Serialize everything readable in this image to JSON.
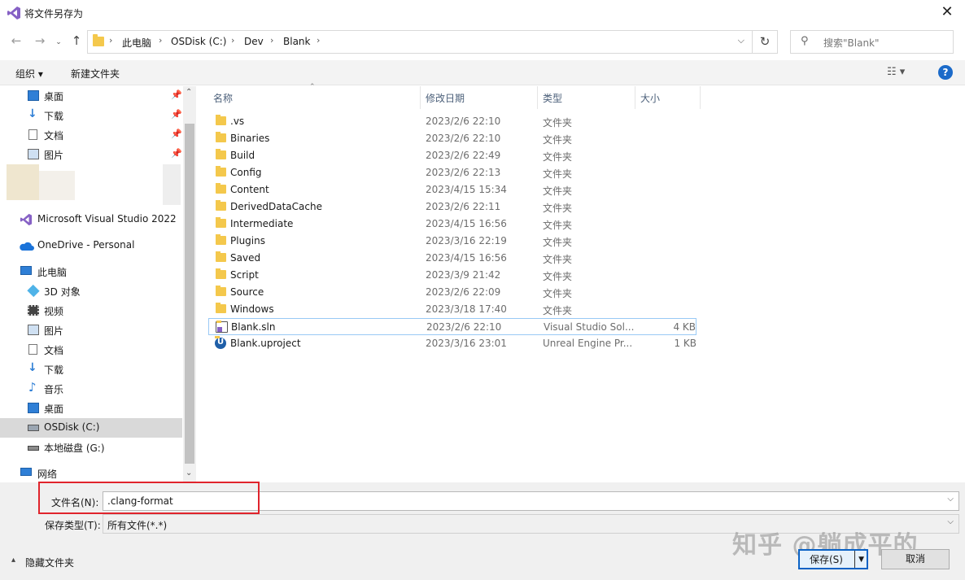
{
  "window": {
    "title": "将文件另存为",
    "close": "✕"
  },
  "address": {
    "crumbs": [
      "此电脑",
      "OSDisk (C:)",
      "Dev",
      "Blank"
    ],
    "search_placeholder": "搜索\"Blank\""
  },
  "toolbar": {
    "organize": "组织 ▾",
    "new_folder": "新建文件夹",
    "help": "?"
  },
  "nav": {
    "quick": [
      {
        "label": "桌面",
        "icon": "desktop-icon"
      },
      {
        "label": "下载",
        "icon": "download-icon"
      },
      {
        "label": "文档",
        "icon": "document-icon"
      },
      {
        "label": "图片",
        "icon": "picture-icon"
      }
    ],
    "vs": "Microsoft Visual Studio 2022",
    "onedrive": "OneDrive - Personal",
    "pc": "此电脑",
    "pc_items": [
      {
        "label": "3D 对象",
        "icon": "3d-objects-icon"
      },
      {
        "label": "视频",
        "icon": "video-icon"
      },
      {
        "label": "图片",
        "icon": "picture-icon"
      },
      {
        "label": "文档",
        "icon": "document-icon"
      },
      {
        "label": "下载",
        "icon": "download-icon"
      },
      {
        "label": "音乐",
        "icon": "music-icon"
      },
      {
        "label": "桌面",
        "icon": "desktop-icon"
      },
      {
        "label": "OSDisk (C:)",
        "icon": "drive-c-icon"
      },
      {
        "label": "本地磁盘 (G:)",
        "icon": "drive-g-icon"
      }
    ],
    "network": "网络"
  },
  "columns": [
    "名称",
    "修改日期",
    "类型",
    "大小"
  ],
  "files": [
    {
      "name": ".vs",
      "date": "2023/2/6 22:10",
      "type": "文件夹",
      "size": ""
    },
    {
      "name": "Binaries",
      "date": "2023/2/6 22:10",
      "type": "文件夹",
      "size": ""
    },
    {
      "name": "Build",
      "date": "2023/2/6 22:49",
      "type": "文件夹",
      "size": ""
    },
    {
      "name": "Config",
      "date": "2023/2/6 22:13",
      "type": "文件夹",
      "size": ""
    },
    {
      "name": "Content",
      "date": "2023/4/15 15:34",
      "type": "文件夹",
      "size": ""
    },
    {
      "name": "DerivedDataCache",
      "date": "2023/2/6 22:11",
      "type": "文件夹",
      "size": ""
    },
    {
      "name": "Intermediate",
      "date": "2023/4/15 16:56",
      "type": "文件夹",
      "size": ""
    },
    {
      "name": "Plugins",
      "date": "2023/3/16 22:19",
      "type": "文件夹",
      "size": ""
    },
    {
      "name": "Saved",
      "date": "2023/4/15 16:56",
      "type": "文件夹",
      "size": ""
    },
    {
      "name": "Script",
      "date": "2023/3/9 21:42",
      "type": "文件夹",
      "size": ""
    },
    {
      "name": "Source",
      "date": "2023/2/6 22:09",
      "type": "文件夹",
      "size": ""
    },
    {
      "name": "Windows",
      "date": "2023/3/18 17:40",
      "type": "文件夹",
      "size": ""
    },
    {
      "name": "Blank.sln",
      "date": "2023/2/6 22:10",
      "type": "Visual Studio Sol...",
      "size": "4 KB"
    },
    {
      "name": "Blank.uproject",
      "date": "2023/3/16 23:01",
      "type": "Unreal Engine Pr...",
      "size": "1 KB"
    }
  ],
  "form": {
    "filename_label": "文件名(N):",
    "filename_value": ".clang-format",
    "filetype_label": "保存类型(T):",
    "filetype_value": "所有文件(*.*)",
    "hide_folders": "隐藏文件夹",
    "save": "保存(S)",
    "cancel": "取消"
  },
  "watermark": "知乎 @躺成平的"
}
